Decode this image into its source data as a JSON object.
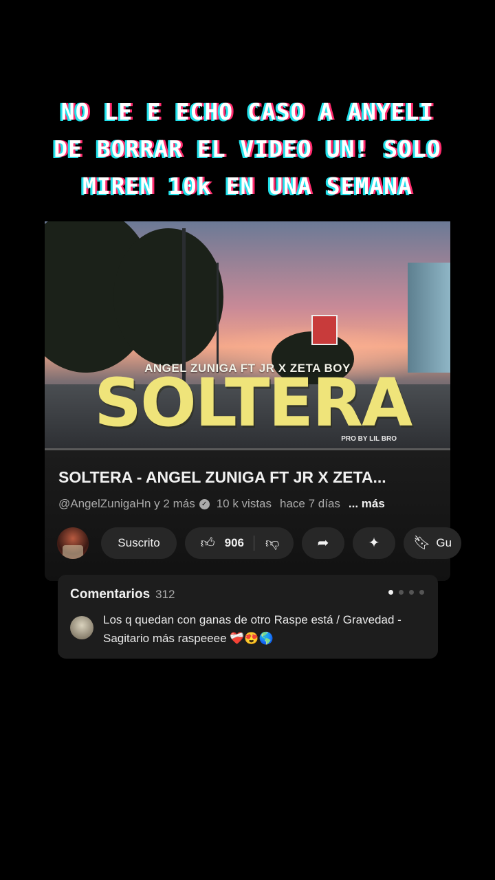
{
  "caption": {
    "line1": "NO LE E ECHO CASO A ANYELI",
    "line2": "DE BORRAR EL VIDEO UN! SOLO",
    "line3": "MIREN 10k EN UNA SEMANA"
  },
  "thumbnail": {
    "artist_line": "ANGEL ZUNIGA FT JR X ZETA BOY",
    "title_art": "SOLTERA",
    "producer": "PRO BY LIL BRO"
  },
  "video": {
    "title": "SOLTERA - ANGEL ZUNIGA FT JR X ZETA...",
    "channel": "@AngelZunigaHn y 2 más",
    "views": "10 k vistas",
    "age": "hace 7 días",
    "more": "... más"
  },
  "actions": {
    "subscribe_label": "Suscrito",
    "likes": "906",
    "save_label": "Gu"
  },
  "comments": {
    "header": "Comentarios",
    "count": "312",
    "top_comment": "Los q quedan con ganas de otro Raspe está / Gravedad - Sagitario más raspeeee ❤️‍🩹😍🌎"
  },
  "icons": {
    "like": "thumbs-up-icon",
    "dislike": "thumbs-down-icon",
    "share": "share-icon",
    "remix": "sparkle-icon",
    "save": "bookmark-icon",
    "verified": "verified-icon"
  }
}
